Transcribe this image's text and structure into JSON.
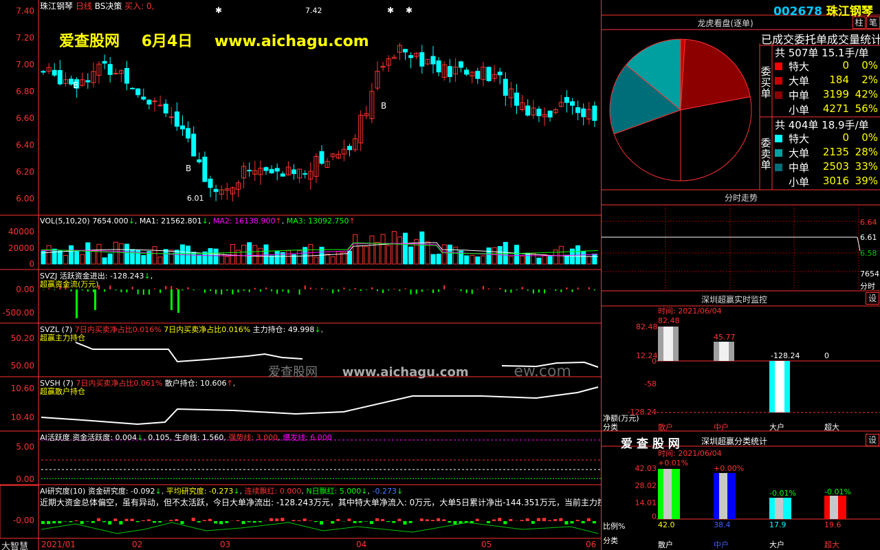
{
  "stock": {
    "name": "珠江钢琴",
    "period": "日线",
    "strategy": "BS决策",
    "buy": "买入: 0,",
    "code": "002678"
  },
  "watermark": {
    "site": "爱查股网",
    "date": "6月4日",
    "url": "www.aichagu.com",
    "mid_site": "爱查股网",
    "mid_url": "www.aichagu.com",
    "mid_tail": "ew.com"
  },
  "price_axis": [
    "7.40",
    "7.20",
    "7.00",
    "6.80",
    "6.60",
    "6.40",
    "6.20",
    "6.00"
  ],
  "price_marks": {
    "high": "7.42",
    "low": "6.01",
    "buy": "B"
  },
  "vol": {
    "label": "VOL(5,10,20)",
    "value": "7654.000",
    "ma1": "MA1: 21562.801",
    "ma2": "MA2: 16138.900",
    "ma3": "MA3: 13092.750",
    "axis": [
      "40000",
      "20000",
      "0"
    ]
  },
  "svzj": {
    "title": "SVZJ",
    "line": "活跃资金进出: -128.243",
    "sub": "超赢资金流(万元)",
    "axis": [
      "0.00",
      "-500.00"
    ]
  },
  "svzl": {
    "title": "SVZL (7)",
    "a": "7日内买卖净占比0.016%",
    "b": "7日内买卖净占比0.016%",
    "c": "主力持仓: 49.998",
    "sub": "超赢主力持仓",
    "axis": [
      "50.20",
      "50.00"
    ]
  },
  "svsh": {
    "title": "SVSH (7)",
    "a": "7日内买卖净占比0.061%",
    "c": "散户持仓: 10.606",
    "sub": "超赢散户持仓",
    "axis": [
      "10.60",
      "10.40"
    ]
  },
  "ai1": {
    "title": "AI活跃度",
    "a": "资金活跃度: 0.004",
    "b": "0.105",
    "c": "生命线: 1.560",
    "d": "强势线: 3.000",
    "e": "爆发线: 6.000",
    "axis": [
      "5.00",
      "0.00"
    ]
  },
  "ai2": {
    "title": "AI研究度(10)",
    "a": "资金研究度: -0.092",
    "b": "平均研究度: -0.273",
    "c": "连续飘红: 0.000",
    "d": "N日飘红: 5.000",
    "e": "-0.273",
    "note": "近期大资金总体偏空，虽有异动，但不太活跃，今日大单净流出: -128.243万元，其中特大单净流入: 0万元，大单5日累计净出-144.351万元，当前主力控盘",
    "axis": [
      "-0.00"
    ]
  },
  "bottom": {
    "brand": "大智慧",
    "dates": [
      "2021/01",
      "02",
      "03",
      "04",
      "05",
      "06"
    ]
  },
  "right": {
    "buttons": [
      "柱",
      "笔"
    ],
    "lh_title": "龙虎看盘(逐单)",
    "lh_sub": "已成交委托单成交量统计",
    "buy_group": "委买单",
    "buy_total": "共 507单 15.1手/单",
    "sell_group": "委卖单",
    "sell_total": "共 404单 18.9手/单",
    "buy_rows": [
      {
        "label": "特大",
        "count": "0",
        "pct": "0%",
        "color": "#ff0000"
      },
      {
        "label": "大单",
        "count": "184",
        "pct": "2%",
        "color": "#c80000"
      },
      {
        "label": "中单",
        "count": "3199",
        "pct": "42%",
        "color": "#8c0000"
      },
      {
        "label": "小单",
        "count": "4271",
        "pct": "56%",
        "color": "#000000"
      }
    ],
    "sell_rows": [
      {
        "label": "特大",
        "count": "0",
        "pct": "0%",
        "color": "#00ffff"
      },
      {
        "label": "大单",
        "count": "2135",
        "pct": "28%",
        "color": "#00a0a0"
      },
      {
        "label": "中单",
        "count": "2503",
        "pct": "33%",
        "color": "#006e78"
      },
      {
        "label": "小单",
        "count": "3016",
        "pct": "39%",
        "color": "#000000"
      }
    ],
    "fs_title": "分时走势",
    "fs_axis": [
      "6.64",
      "6.61",
      "6.58",
      "7654",
      "分时"
    ],
    "mon_title": "深圳超赢实时监控",
    "mon_btn": "设",
    "mon_time": "时间: 2021/06/04",
    "mon_axis": [
      "82.48",
      "12.24",
      "0",
      "-58",
      "-128.24"
    ],
    "mon_unit": "净额(万元)",
    "mon_cat": "分类",
    "mon_values": [
      "82.48",
      "45.77",
      "-128.24",
      "0"
    ],
    "mon_labels": [
      "散户",
      "中户",
      "大户",
      "超大"
    ],
    "cls_brand": "爱 查 股 网",
    "cls_title": "深圳超赢分类统计",
    "cls_btn": "设",
    "cls_time": "时间: 2021/06/04",
    "cls_axis": [
      "42.03",
      "28.02",
      "14.01",
      "0"
    ],
    "cls_pcts": [
      "+0.01%",
      "+0.00%",
      "-0.01%",
      "-0.01%"
    ],
    "cls_ratio": "比例%",
    "cls_cat": "分类",
    "cls_values": [
      "42.0",
      "38.4",
      "17.9",
      "19.6"
    ],
    "cls_labels": [
      "散户",
      "中户",
      "大户",
      "超大"
    ]
  }
}
